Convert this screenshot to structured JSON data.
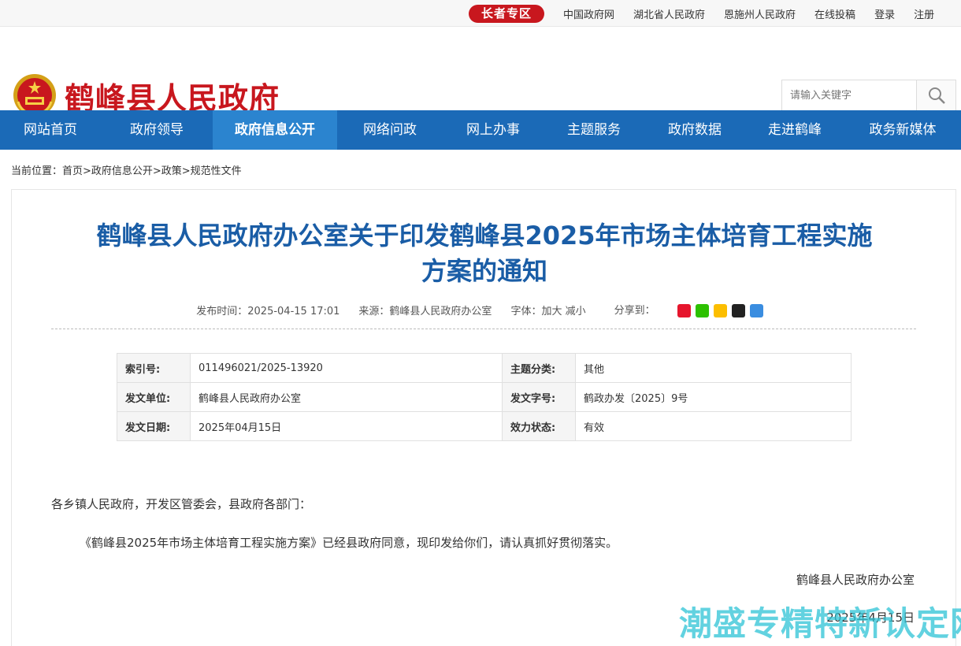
{
  "topbar": {
    "elder_zone": "长者专区",
    "links": [
      "中国政府网",
      "湖北省人民政府",
      "恩施州人民政府",
      "在线投稿",
      "登录",
      "注册"
    ]
  },
  "header": {
    "site_title": "鹤峰县人民政府",
    "search_placeholder": "请输入关键字"
  },
  "nav": {
    "items": [
      "网站首页",
      "政府领导",
      "政府信息公开",
      "网络问政",
      "网上办事",
      "主题服务",
      "政府数据",
      "走进鹤峰",
      "政务新媒体"
    ],
    "active_index": 2
  },
  "breadcrumb": "当前位置：首页>政府信息公开>政策>规范性文件",
  "article": {
    "title_line1": "鹤峰县人民政府办公室关于印发鹤峰县2025年市场主体培育工程实施",
    "title_line2": "方案的通知",
    "publish_time": "发布时间：2025-04-15 17:01",
    "source": "来源：鹤峰县人民政府办公室",
    "font_size": "字体：加大 减小",
    "share_label": "分享到：",
    "share_icons": [
      "weibo-icon",
      "wechat-icon",
      "qzone-icon",
      "qq-icon",
      "more-share-icon"
    ]
  },
  "info_table": {
    "index_no_label": "索引号:",
    "index_no": "011496021/2025-13920",
    "topic_label": "主题分类:",
    "topic": "其他",
    "issuer_label": "发文单位:",
    "issuer": "鹤峰县人民政府办公室",
    "doc_no_label": "发文字号:",
    "doc_no": "鹤政办发〔2025〕9号",
    "date_label": "发文日期:",
    "date": "2025年04月15日",
    "status_label": "效力状态:",
    "status": "有效"
  },
  "body": {
    "salutation": "各乡镇人民政府，开发区管委会，县政府各部门：",
    "paragraph": "《鹤峰县2025年市场主体培育工程实施方案》已经县政府同意，现印发给你们，请认真抓好贯彻落实。",
    "signature": "鹤峰县人民政府办公室",
    "sign_date": "2025年4月15日"
  },
  "watermark": "潮盛专精特新认定网",
  "colors": {
    "brand_red": "#c8171e",
    "nav_blue": "#1b6ab7",
    "nav_active": "#2b84cf",
    "title_blue": "#1a5da6"
  }
}
